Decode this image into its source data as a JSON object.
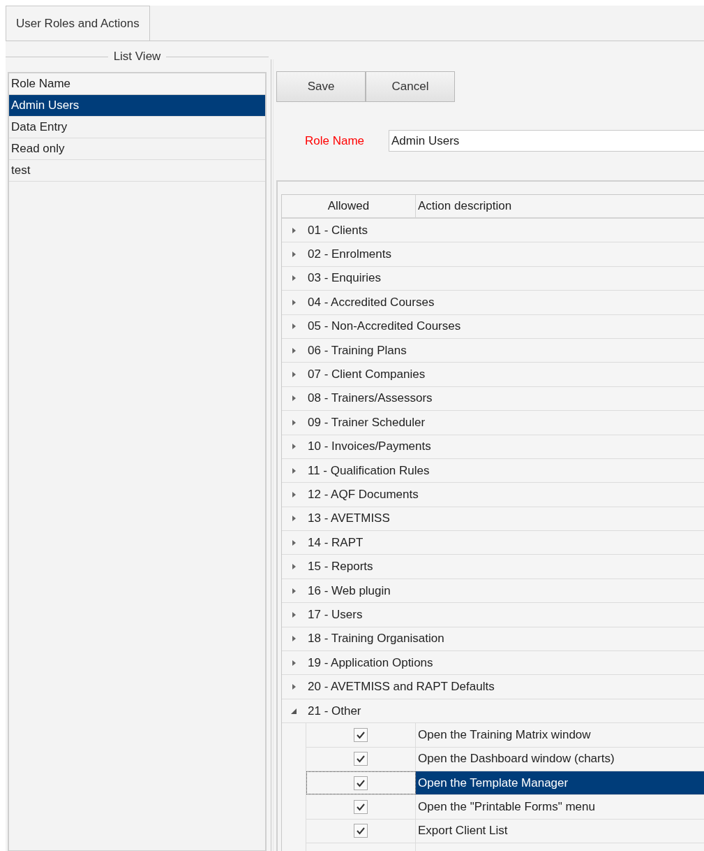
{
  "tabs": [
    "User Roles and Actions"
  ],
  "list_view": {
    "title": "List View",
    "column": "Role Name",
    "rows": [
      {
        "label": "Admin Users",
        "selected": true
      },
      {
        "label": "Data Entry",
        "selected": false
      },
      {
        "label": "Read only",
        "selected": false
      },
      {
        "label": "test",
        "selected": false
      }
    ]
  },
  "buttons": [
    "Save",
    "Cancel"
  ],
  "role_name": {
    "label": "Role Name",
    "value": "Admin Users"
  },
  "actions": {
    "columns": [
      "Allowed",
      "Action description"
    ],
    "groups": [
      {
        "label": "01 - Clients",
        "expanded": false
      },
      {
        "label": "02 - Enrolments",
        "expanded": false
      },
      {
        "label": "03 - Enquiries",
        "expanded": false
      },
      {
        "label": "04 - Accredited Courses",
        "expanded": false
      },
      {
        "label": "05 - Non-Accredited Courses",
        "expanded": false
      },
      {
        "label": "06 - Training Plans",
        "expanded": false
      },
      {
        "label": "07 - Client Companies",
        "expanded": false
      },
      {
        "label": "08 - Trainers/Assessors",
        "expanded": false
      },
      {
        "label": "09 - Trainer Scheduler",
        "expanded": false
      },
      {
        "label": "10 - Invoices/Payments",
        "expanded": false
      },
      {
        "label": "11 - Qualification Rules",
        "expanded": false
      },
      {
        "label": "12 - AQF Documents",
        "expanded": false
      },
      {
        "label": "13 - AVETMISS",
        "expanded": false
      },
      {
        "label": "14 - RAPT",
        "expanded": false
      },
      {
        "label": "15 - Reports",
        "expanded": false
      },
      {
        "label": "16 - Web plugin",
        "expanded": false
      },
      {
        "label": "17 - Users",
        "expanded": false
      },
      {
        "label": "18 - Training Organisation",
        "expanded": false
      },
      {
        "label": "19 - Application Options",
        "expanded": false
      },
      {
        "label": "20 - AVETMISS and RAPT Defaults",
        "expanded": false
      },
      {
        "label": "21 - Other",
        "expanded": true,
        "children": [
          {
            "description": "Open the Training Matrix window",
            "checked": true,
            "selected": false
          },
          {
            "description": "Open the Dashboard window (charts)",
            "checked": true,
            "selected": false
          },
          {
            "description": "Open the Template Manager",
            "checked": true,
            "selected": true
          },
          {
            "description": "Open the \"Printable Forms\" menu",
            "checked": true,
            "selected": false
          },
          {
            "description": "Export Client List",
            "checked": true,
            "selected": false
          }
        ]
      }
    ]
  }
}
